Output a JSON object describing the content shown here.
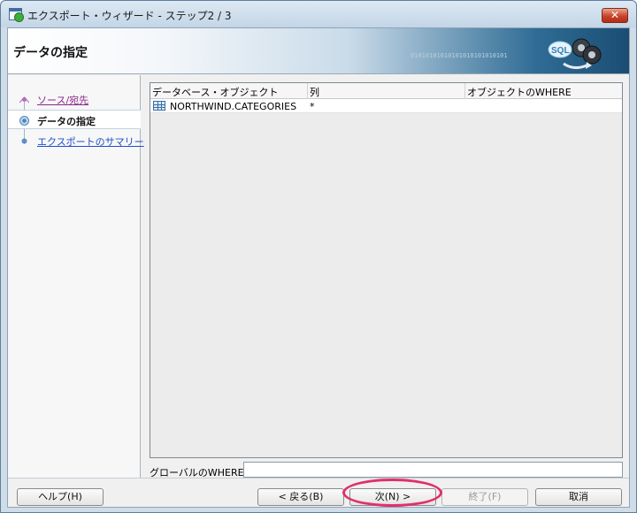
{
  "window": {
    "title": "エクスポート・ウィザード - ステップ2 / 3",
    "close_label": "✕"
  },
  "header": {
    "title": "データの指定",
    "binary_text": "01010101010101010101010101"
  },
  "nav": {
    "items": [
      {
        "label": "ソース/宛先",
        "state": "visited"
      },
      {
        "label": "データの指定",
        "state": "current"
      },
      {
        "label": "エクスポートのサマリー",
        "state": "link"
      }
    ]
  },
  "table": {
    "columns": [
      "データベース・オブジェクト",
      "列",
      "オブジェクトのWHERE"
    ],
    "rows": [
      {
        "object": "NORTHWIND.CATEGORIES",
        "columns": "*",
        "where": ""
      }
    ]
  },
  "global_where": {
    "label": "グローバルのWHERE:",
    "value": ""
  },
  "buttons": {
    "help": "ヘルプ(H)",
    "back": "< 戻る(B)",
    "next": "次(N) >",
    "finish": "終了(F)",
    "cancel": "取消"
  },
  "colors": {
    "link": "#1f4ec9",
    "visited": "#8b2a8b",
    "highlight": "#e0306b"
  }
}
